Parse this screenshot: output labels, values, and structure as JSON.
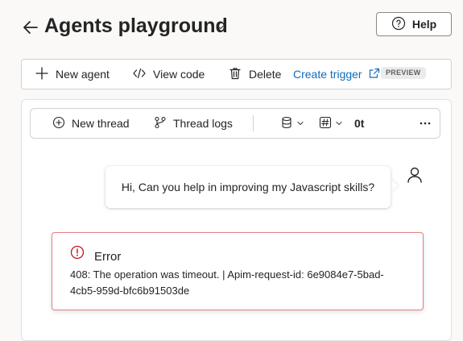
{
  "header": {
    "title": "Agents playground",
    "help_label": "Help"
  },
  "toolbar": {
    "new_agent_label": "New agent",
    "view_code_label": "View code",
    "delete_label": "Delete",
    "create_trigger_label": "Create trigger",
    "preview_badge": "PREVIEW"
  },
  "thread_bar": {
    "new_thread_label": "New thread",
    "thread_logs_label": "Thread logs",
    "token_count": "0t"
  },
  "chat": {
    "user_message": "Hi, Can you help in improving my Javascript skills?",
    "error_title": "Error",
    "error_message": "408: The operation was timeout. | Apim-request-id: 6e9084e7-5bad-4cb5-959d-bfc6b91503de"
  },
  "colors": {
    "link": "#0f6cbd",
    "error_border": "#e37d80",
    "error_icon": "#c50f1f"
  }
}
